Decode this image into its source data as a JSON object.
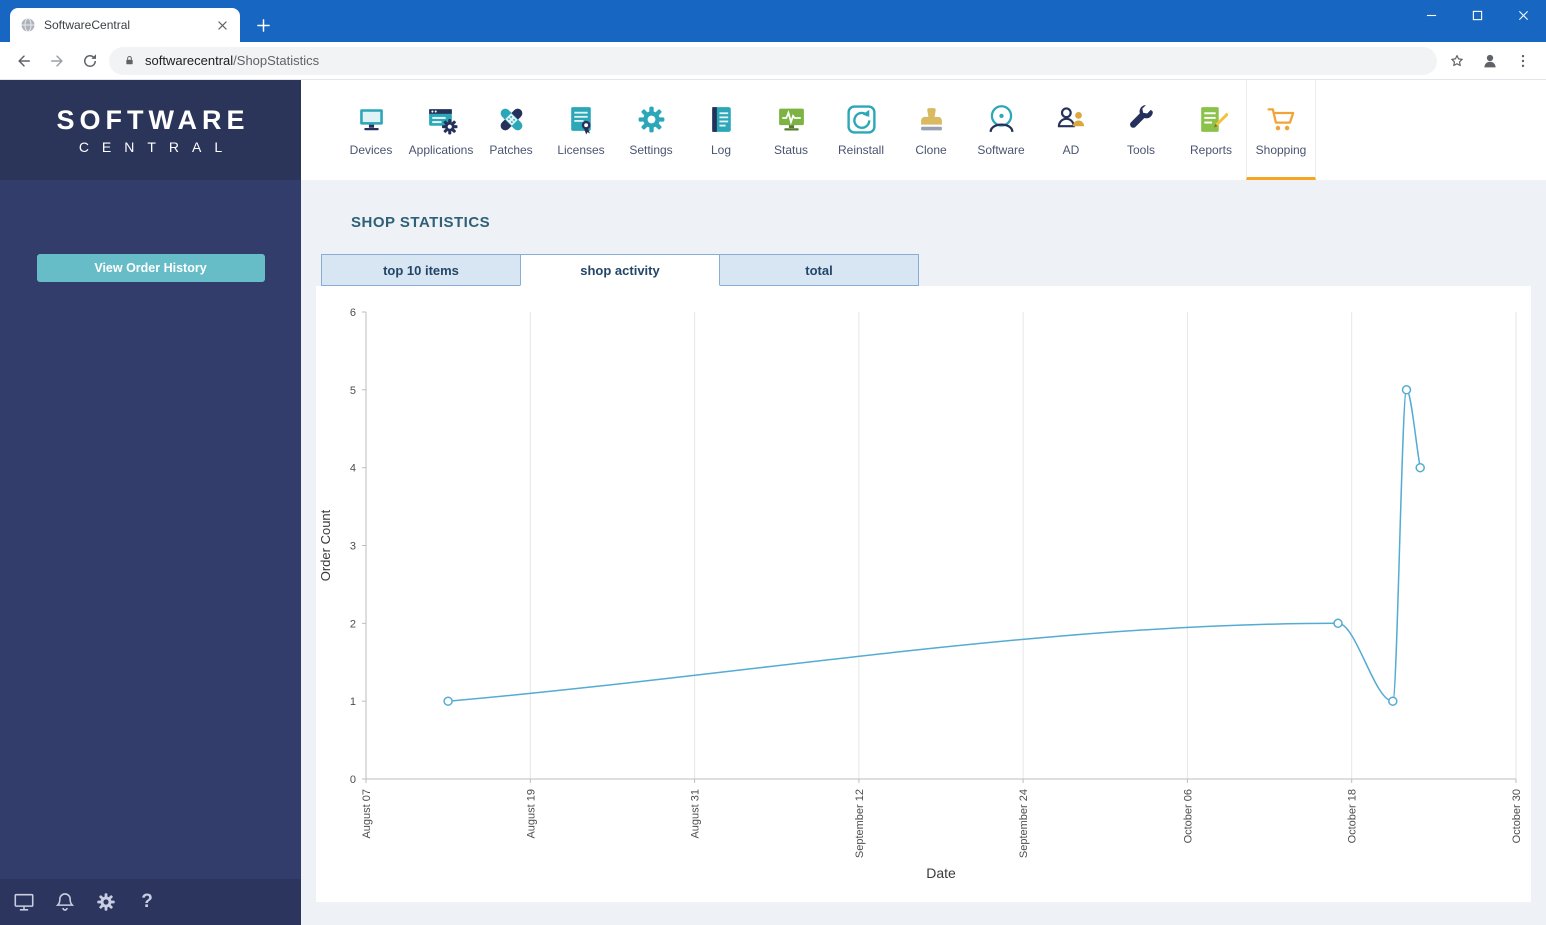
{
  "colors": {
    "titlebar_blue": "#1766c2",
    "sidebar_navy": "#333d6b",
    "sidebar_header_navy": "#2b3459",
    "teal_accent": "#67bdc7",
    "orange_accent": "#f6a525",
    "chart_line": "#54abd4"
  },
  "browser": {
    "tab_title": "SoftwareCentral",
    "url_domain": "softwarecentral",
    "url_path": "/ShopStatistics"
  },
  "sidebar": {
    "logo_line1": "SOFTWARE",
    "logo_line2": "CENTRAL",
    "order_history_button": "View Order History",
    "bottom_icons": [
      {
        "id": "computer"
      },
      {
        "id": "notifications"
      },
      {
        "id": "settings"
      },
      {
        "id": "help"
      }
    ]
  },
  "nav": {
    "items": [
      {
        "id": "devices",
        "label": "Devices",
        "active": false
      },
      {
        "id": "applications",
        "label": "Applications",
        "active": false
      },
      {
        "id": "patches",
        "label": "Patches",
        "active": false
      },
      {
        "id": "licenses",
        "label": "Licenses",
        "active": false
      },
      {
        "id": "settings",
        "label": "Settings",
        "active": false
      },
      {
        "id": "log",
        "label": "Log",
        "active": false
      },
      {
        "id": "status",
        "label": "Status",
        "active": false
      },
      {
        "id": "reinstall",
        "label": "Reinstall",
        "active": false
      },
      {
        "id": "clone",
        "label": "Clone",
        "active": false
      },
      {
        "id": "software",
        "label": "Software",
        "active": false
      },
      {
        "id": "ad",
        "label": "AD",
        "active": false
      },
      {
        "id": "tools",
        "label": "Tools",
        "active": false
      },
      {
        "id": "reports",
        "label": "Reports",
        "active": false
      },
      {
        "id": "shopping",
        "label": "Shopping",
        "active": true
      }
    ]
  },
  "main": {
    "heading": "SHOP STATISTICS",
    "tabs": [
      {
        "label": "top 10 items",
        "active": false
      },
      {
        "label": "shop activity",
        "active": true
      },
      {
        "label": "total",
        "active": false
      }
    ]
  },
  "chart_data": {
    "type": "line",
    "title": "",
    "xlabel": "Date",
    "ylabel": "Order Count",
    "ylim": [
      0,
      6
    ],
    "y_ticks": [
      0,
      1,
      2,
      3,
      4,
      5,
      6
    ],
    "x_ticks": [
      "August 07",
      "August 19",
      "August 31",
      "September 12",
      "September 24",
      "October 06",
      "October 18",
      "October 30"
    ],
    "grid": "vertical",
    "legend": "none",
    "points": [
      {
        "x": "August 13",
        "y": 1
      },
      {
        "x": "October 17",
        "y": 2
      },
      {
        "x": "October 21",
        "y": 1
      },
      {
        "x": "October 22",
        "y": 5
      },
      {
        "x": "October 23",
        "y": 4
      }
    ]
  }
}
